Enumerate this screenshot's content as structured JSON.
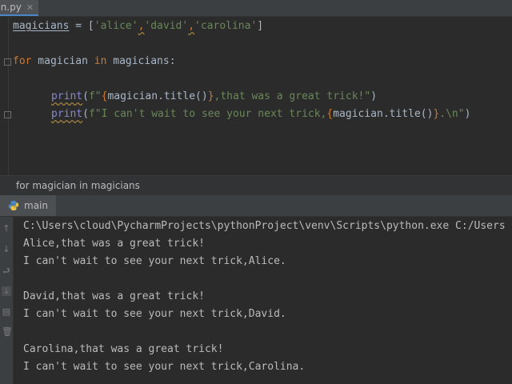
{
  "tab": {
    "label": "ain.py",
    "close": "✕"
  },
  "code": {
    "line1": {
      "var": "magicians",
      "eq": " = [",
      "s1": "'alice'",
      "c1": ",",
      "s2": "'david'",
      "c2": ",",
      "s3": "'carolina'",
      "end": "]"
    },
    "line2": {
      "kw_for": "for",
      "sp1": " magician ",
      "kw_in": "in",
      "rest": " magicians:"
    },
    "line3": {
      "fn": "print",
      "p1": "(",
      "f": "f\"",
      "b1": "{",
      "expr": "magician.title()",
      "b2": "}",
      "str": ",that was a great trick!\"",
      "p2": ")"
    },
    "line4": {
      "fn": "print",
      "p1": "(",
      "str1": "f\"I can't wait to see your next trick,",
      "b1": "{",
      "expr": "magician.title()",
      "b2": "}",
      "str2": ".\\n\"",
      "p2": ")"
    }
  },
  "breadcrumb": "for magician in magicians",
  "run": {
    "tab_label": "main"
  },
  "console": {
    "lines": [
      "C:\\Users\\cloud\\PycharmProjects\\pythonProject\\venv\\Scripts\\python.exe C:/Users",
      "Alice,that was a great trick!",
      "I can't wait to see your next trick,Alice.",
      "",
      "David,that was a great trick!",
      "I can't wait to see your next trick,David.",
      "",
      "Carolina,that was a great trick!",
      "I can't wait to see your next trick,Carolina."
    ]
  },
  "colors": {
    "keyword": "#cc7832",
    "string": "#6a8759",
    "builtin": "#8888c6",
    "text": "#a9b7c6",
    "accent": "#4a88c7"
  }
}
